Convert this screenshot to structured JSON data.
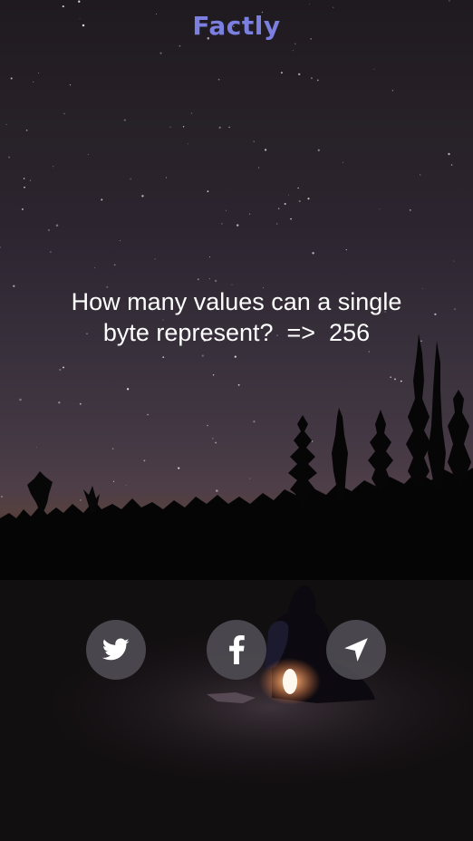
{
  "app": {
    "title": "Factly",
    "title_color": "#7b7fe0"
  },
  "fact": {
    "text": "How many values can a single\nbyte represent?  =>  256"
  },
  "share_buttons": [
    {
      "icon": "twitter-icon"
    },
    {
      "icon": "facebook-icon"
    },
    {
      "icon": "navigation-arrow-icon"
    }
  ],
  "colors": {
    "button_bg": "#4e4c52",
    "text": "#ffffff"
  }
}
